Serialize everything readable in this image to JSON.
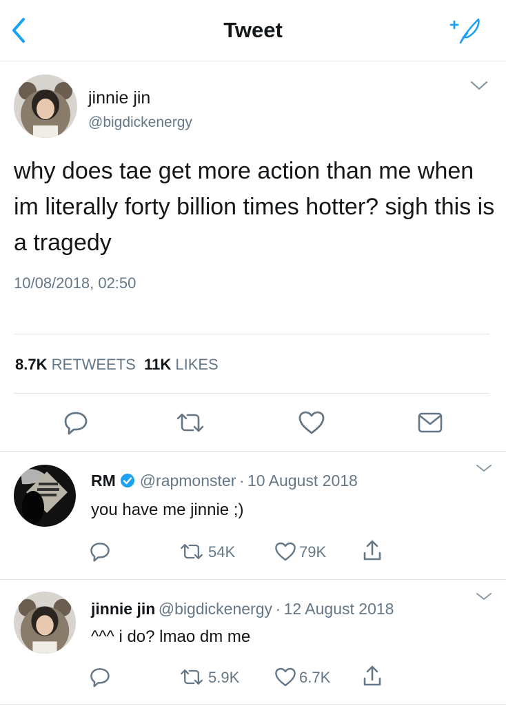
{
  "nav": {
    "title": "Tweet"
  },
  "tweet": {
    "name": "jinnie jin",
    "handle": "@bigdickenergy",
    "text": "why does tae get more action than me when im literally forty billion times hotter? sigh this is a tragedy",
    "timestamp": "10/08/2018, 02:50",
    "retweet_count": "8.7K",
    "retweet_label": "RETWEETS",
    "like_count": "11K",
    "like_label": "LIKES"
  },
  "replies": [
    {
      "name": "RM",
      "verified": true,
      "handle": "@rapmonster",
      "separator": "·",
      "date": "10 August 2018",
      "text": "you have me jinnie ;)",
      "retweets": "54K",
      "likes": "79K"
    },
    {
      "name": "jinnie jin",
      "verified": false,
      "handle": "@bigdickenergy",
      "separator": "·",
      "date": "12 August 2018",
      "text": "^^^ i do? lmao dm me",
      "retweets": "5.9K",
      "likes": "6.7K"
    }
  ],
  "colors": {
    "accent": "#1da1f2",
    "secondary": "#657786",
    "divider": "#dfe3e7"
  },
  "icons": [
    "back-chevron-icon",
    "compose-icon",
    "chevron-down-icon",
    "reply-icon",
    "retweet-icon",
    "like-icon",
    "share-icon",
    "message-icon",
    "verified-badge-icon"
  ]
}
